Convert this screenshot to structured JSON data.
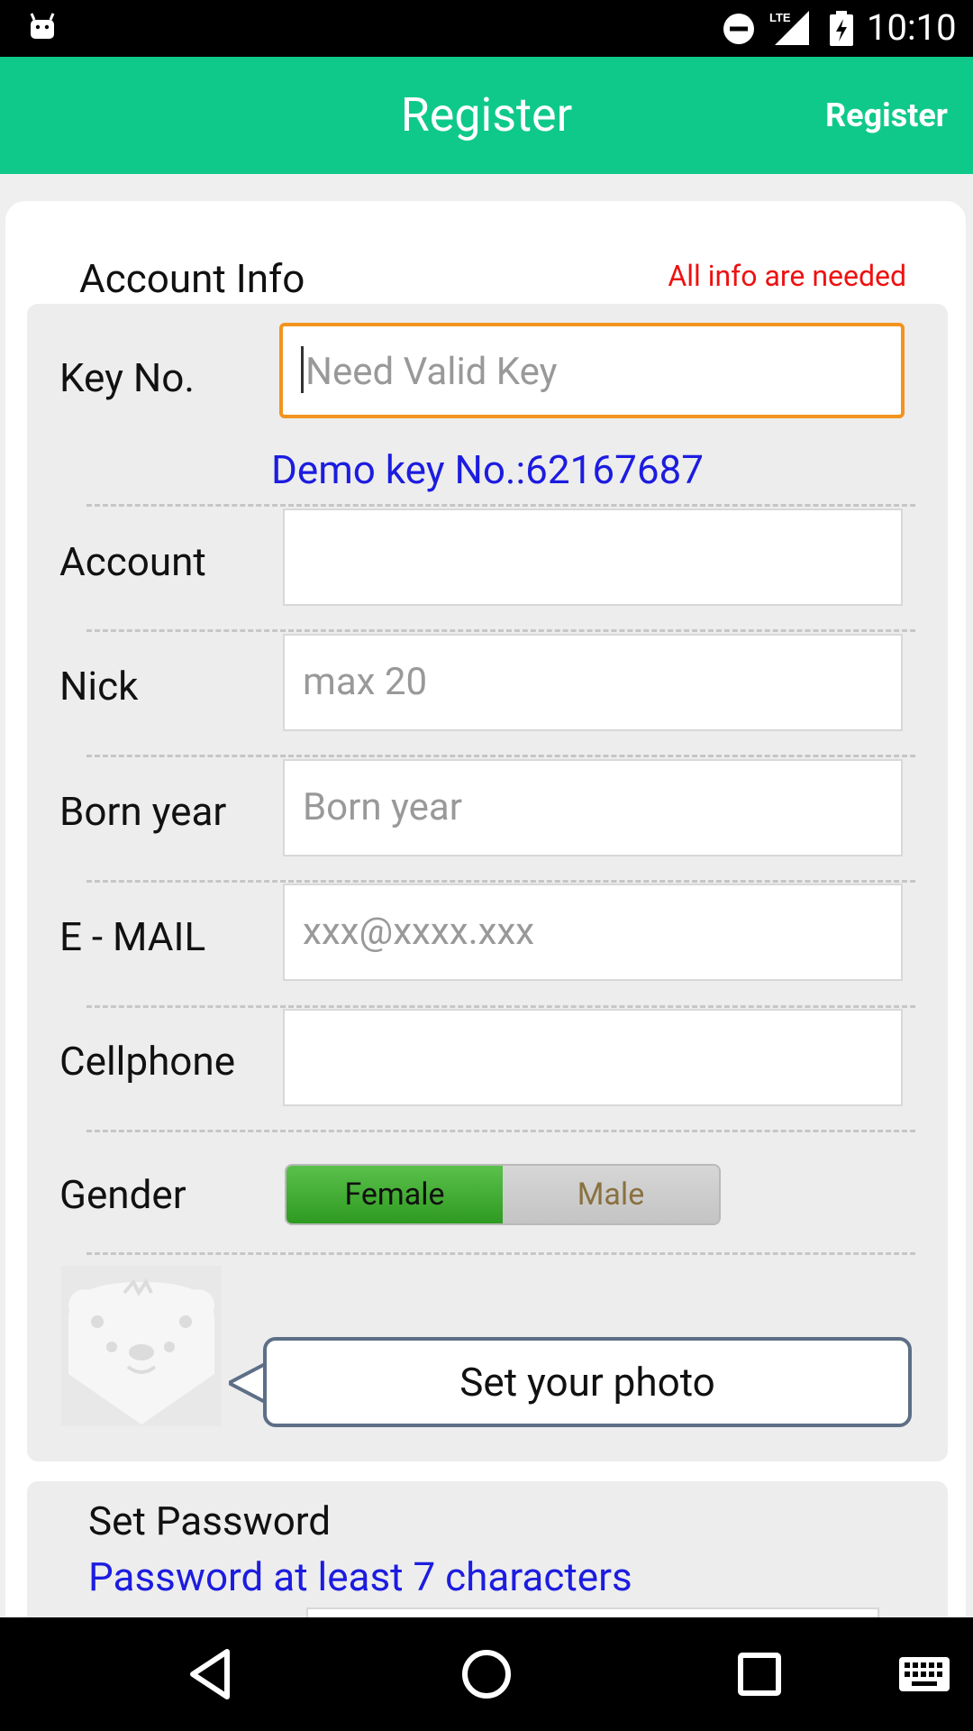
{
  "status_bar": {
    "time": "10:10",
    "network": "LTE",
    "icons": [
      "android-icon",
      "do-not-disturb-icon",
      "lte-signal-icon",
      "battery-charging-icon"
    ]
  },
  "app_bar": {
    "title": "Register",
    "action_label": "Register",
    "color": "#0fc98b"
  },
  "account_info": {
    "title": "Account Info",
    "required_note": "All info are needed",
    "key": {
      "label": "Key No.",
      "placeholder": "Need Valid Key",
      "value": ""
    },
    "demo_key": "Demo key No.:62167687",
    "account": {
      "label": "Account",
      "placeholder": "",
      "value": ""
    },
    "nick": {
      "label": "Nick",
      "placeholder": "max 20",
      "value": ""
    },
    "born_year": {
      "label": "Born year",
      "placeholder": "Born year",
      "value": ""
    },
    "email": {
      "label": "E - MAIL",
      "placeholder": "xxx@xxxx.xxx",
      "value": ""
    },
    "cellphone": {
      "label": "Cellphone",
      "placeholder": "",
      "value": ""
    },
    "gender": {
      "label": "Gender",
      "options": [
        "Female",
        "Male"
      ],
      "selected": "Female"
    },
    "photo_button": "Set your photo"
  },
  "password": {
    "title": "Set Password",
    "hint": "Password at least 7 characters"
  },
  "nav_bar": {
    "icons": [
      "back-icon",
      "home-icon",
      "recents-icon",
      "keyboard-icon"
    ]
  }
}
